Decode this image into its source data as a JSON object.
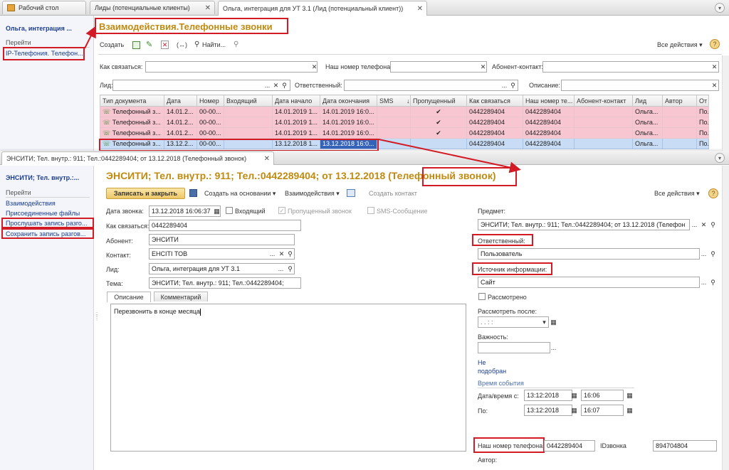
{
  "tabs": [
    {
      "label": "Рабочий стол"
    },
    {
      "label": "Лиды (потенциальные клиенты)"
    },
    {
      "label": "Ольга, интеграция для УТ 3.1 (Лид (потенциальный клиент))"
    }
  ],
  "bg_sidebar": {
    "title": "Ольга, интеграция ...",
    "goto": "Перейти",
    "items": [
      "IP-Телефония. Телефон..."
    ]
  },
  "list": {
    "title": "Взаимодействия.Телефонные звонки",
    "toolbar": {
      "create": "Создать",
      "find": "Найти...",
      "all_actions": "Все действия"
    },
    "filters": {
      "how_contact": "Как связаться:",
      "our_phone": "Наш номер телефона:",
      "subscriber": "Абонент-контакт:",
      "lead": "Лид:",
      "responsible": "Ответственный:",
      "description": "Описание:"
    },
    "columns": [
      "Тип документа",
      "Дата",
      "Номер",
      "Входящий",
      "Дата начало",
      "Дата окончания",
      "SMS",
      "Пропущенный",
      "Как связаться",
      "Наш номер те...",
      "Абонент-контакт",
      "Лид",
      "Автор",
      "От"
    ],
    "rows": [
      {
        "type": "Телефонный з...",
        "date": "14.01.2...",
        "num": "00-00...",
        "in": "",
        "start": "14.01.2019 1...",
        "end": "14.01.2019 16:0...",
        "sms": "",
        "missed": "✔",
        "how": "0442289404",
        "our": "0442289404",
        "sub": "",
        "lead": "Ольга...",
        "author": "",
        "from": "По."
      },
      {
        "type": "Телефонный з...",
        "date": "14.01.2...",
        "num": "00-00...",
        "in": "",
        "start": "14.01.2019 1...",
        "end": "14.01.2019 16:0...",
        "sms": "",
        "missed": "✔",
        "how": "0442289404",
        "our": "0442289404",
        "sub": "",
        "lead": "Ольга...",
        "author": "",
        "from": "По."
      },
      {
        "type": "Телефонный з...",
        "date": "14.01.2...",
        "num": "00-00...",
        "in": "",
        "start": "14.01.2019 1...",
        "end": "14.01.2019 16:0...",
        "sms": "",
        "missed": "✔",
        "how": "0442289404",
        "our": "0442289404",
        "sub": "",
        "lead": "Ольга...",
        "author": "",
        "from": "По."
      },
      {
        "type": "Телефонный з...",
        "date": "13.12.2...",
        "num": "00-00...",
        "in": "",
        "start": "13.12.2018 1...",
        "end": "13.12.2018 16:0...",
        "sms": "",
        "missed": "",
        "how": "0442289404",
        "our": "0442289404",
        "sub": "",
        "lead": "Ольга...",
        "author": "",
        "from": "По."
      }
    ]
  },
  "doc_tab": {
    "label": "ЭНСИТИ; Тел. внутр.: 911; Тел.:0442289404; от 13.12.2018 (Телефонный звонок)"
  },
  "doc_sidebar": {
    "title": "ЭНСИТИ; Тел. внутр.:...",
    "goto": "Перейти",
    "items": [
      "Взаимодействия",
      "Присоединенные файлы",
      "Прослушать запись разго...",
      "Сохранить запись разгов..."
    ]
  },
  "doc": {
    "title_main": "ЭНСИТИ; Тел. внутр.: 911; Тел.:0442289404;  от 13.12.2018 ",
    "title_type": "(Телефонный звонок)",
    "toolbar": {
      "save_close": "Записать и закрыть",
      "create_based": "Создать на основании",
      "interactions": "Взаимодействия",
      "create_contact": "Создать контакт",
      "all_actions": "Все действия"
    },
    "call_date_label": "Дата звонка:",
    "call_date": "13.12.2018 16:06:37",
    "incoming": "Входящий",
    "missed": "Пропущенный звонок",
    "sms": "SMS-Сообщение",
    "how_label": "Как связаться:",
    "how": "0442289404",
    "subscriber_label": "Абонент:",
    "subscriber": "ЭНСИТИ",
    "contact_label": "Контакт:",
    "contact": "ЕНСІТІ ТОВ",
    "lead_label": "Лид:",
    "lead": "Ольга, интеграция для УТ 3.1",
    "topic_label": "Тема:",
    "topic": "ЭНСИТИ; Тел. внутр.: 911; Тел.:0442289404;",
    "tab_desc": "Описание",
    "tab_comment": "Комментарий",
    "description": "Перезвонить в конце месяца",
    "subject_label": "Предмет:",
    "subject": "ЭНСИТИ; Тел. внутр.: 911; Тел.:0442289404;  от 13.12.2018 (Телефон",
    "responsible_label": "Ответственный:",
    "responsible": "Пользователь",
    "source_label": "Источник информации:",
    "source": "Сайт",
    "reviewed": "Рассмотрено",
    "review_after_label": "Рассмотреть после:",
    "review_after": " .  .       :  :",
    "importance_label": "Важность:",
    "not_selected_1": "Не",
    "not_selected_2": "подобран",
    "event_time": "Время события",
    "from_label": "Дата/время с:",
    "from_date": "13:12:2018",
    "from_time": "16:06",
    "to_label": "По:",
    "to_date": "13:12:2018",
    "to_time": "16:07",
    "our_phone_label": "Наш номер телефона",
    "our_phone": "0442289404",
    "call_id_label": "IDзвонка",
    "call_id": "894704804",
    "author_label": "Автор:"
  },
  "colors": {
    "accent": "#c08a0f",
    "red": "#d21b25",
    "link": "#1a3d8f",
    "row_pink": "#f7c6d1",
    "row_sel": "#c8dcf5"
  }
}
